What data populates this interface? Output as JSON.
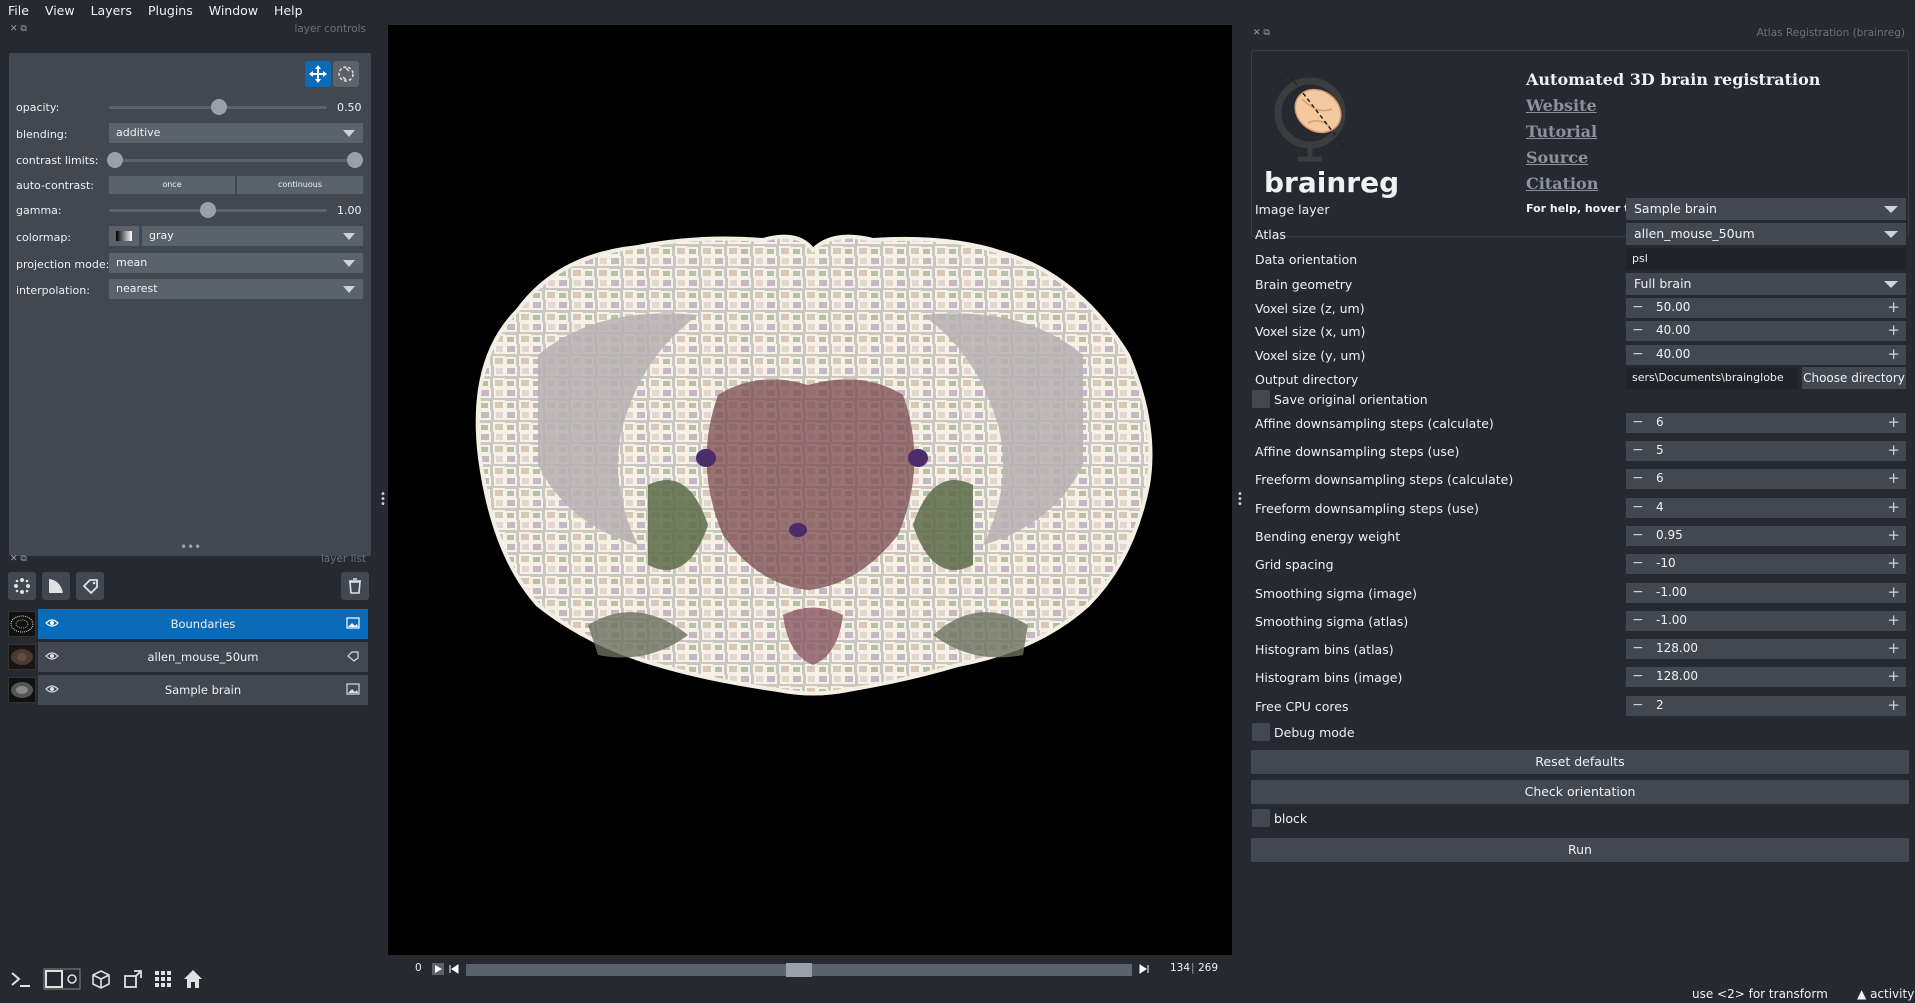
{
  "menu": [
    "File",
    "View",
    "Layers",
    "Plugins",
    "Window",
    "Help"
  ],
  "layer_controls": {
    "dock_title": "layer controls",
    "opacity_label": "opacity:",
    "opacity_value": "0.50",
    "blending_label": "blending:",
    "blending_value": "additive",
    "contrast_label": "contrast limits:",
    "autocontrast_label": "auto-contrast:",
    "once_label": "once",
    "continuous_label": "continuous",
    "gamma_label": "gamma:",
    "gamma_value": "1.00",
    "colormap_label": "colormap:",
    "colormap_value": "gray",
    "projection_label": "projection mode:",
    "projection_value": "mean",
    "interpolation_label": "interpolation:",
    "interpolation_value": "nearest"
  },
  "layer_list": {
    "dock_title": "layer list",
    "layers": [
      {
        "name": "Boundaries",
        "type_icon": "image-icon",
        "selected": true
      },
      {
        "name": "allen_mouse_50um",
        "type_icon": "label-icon",
        "selected": false
      },
      {
        "name": "Sample brain",
        "type_icon": "image-icon",
        "selected": false
      }
    ]
  },
  "dims": {
    "start": "0",
    "current": "134",
    "total": "269"
  },
  "plugin": {
    "dock_title": "Atlas Registration (brainreg)",
    "header_title": "Automated 3D brain registration",
    "links": [
      "Website",
      "Tutorial",
      "Source",
      "Citation"
    ],
    "help": "For help, hover the cursor over each parameter.",
    "brand": "brainreg",
    "image_layer_label": "Image layer",
    "image_layer_value": "Sample brain",
    "atlas_label": "Atlas",
    "atlas_value": "allen_mouse_50um",
    "orientation_label": "Data orientation",
    "orientation_value": "psl",
    "geometry_label": "Brain geometry",
    "geometry_value": "Full brain",
    "spin_params": [
      {
        "label": "Voxel size (z, um)",
        "value": "50.00"
      },
      {
        "label": "Voxel size (x, um)",
        "value": "40.00"
      },
      {
        "label": "Voxel size (y, um)",
        "value": "40.00"
      }
    ],
    "output_label": "Output directory",
    "output_value": "sers\\Documents\\brainglobe",
    "choose_dir": "Choose directory",
    "save_orientation": "Save original orientation",
    "spin_params2": [
      {
        "label": "Affine downsampling steps (calculate)",
        "value": "6"
      },
      {
        "label": "Affine downsampling steps (use)",
        "value": "5"
      },
      {
        "label": "Freeform downsampling steps (calculate)",
        "value": "6"
      },
      {
        "label": "Freeform downsampling steps (use)",
        "value": "4"
      },
      {
        "label": "Bending energy weight",
        "value": "0.95"
      },
      {
        "label": "Grid spacing",
        "value": "-10"
      },
      {
        "label": "Smoothing sigma (image)",
        "value": "-1.00"
      },
      {
        "label": "Smoothing sigma (atlas)",
        "value": "-1.00"
      },
      {
        "label": "Histogram bins (atlas)",
        "value": "128.00"
      },
      {
        "label": "Histogram bins (image)",
        "value": "128.00"
      },
      {
        "label": "Free CPU cores",
        "value": "2"
      }
    ],
    "debug_mode": "Debug mode",
    "reset_defaults": "Reset defaults",
    "check_orientation": "Check orientation",
    "block": "block",
    "run": "Run"
  },
  "status": {
    "hint": "use <2> for transform",
    "activity": "activity"
  },
  "colors": {
    "selected_layer": "#0a6bb8",
    "panel": "#414851",
    "background": "#262930"
  }
}
